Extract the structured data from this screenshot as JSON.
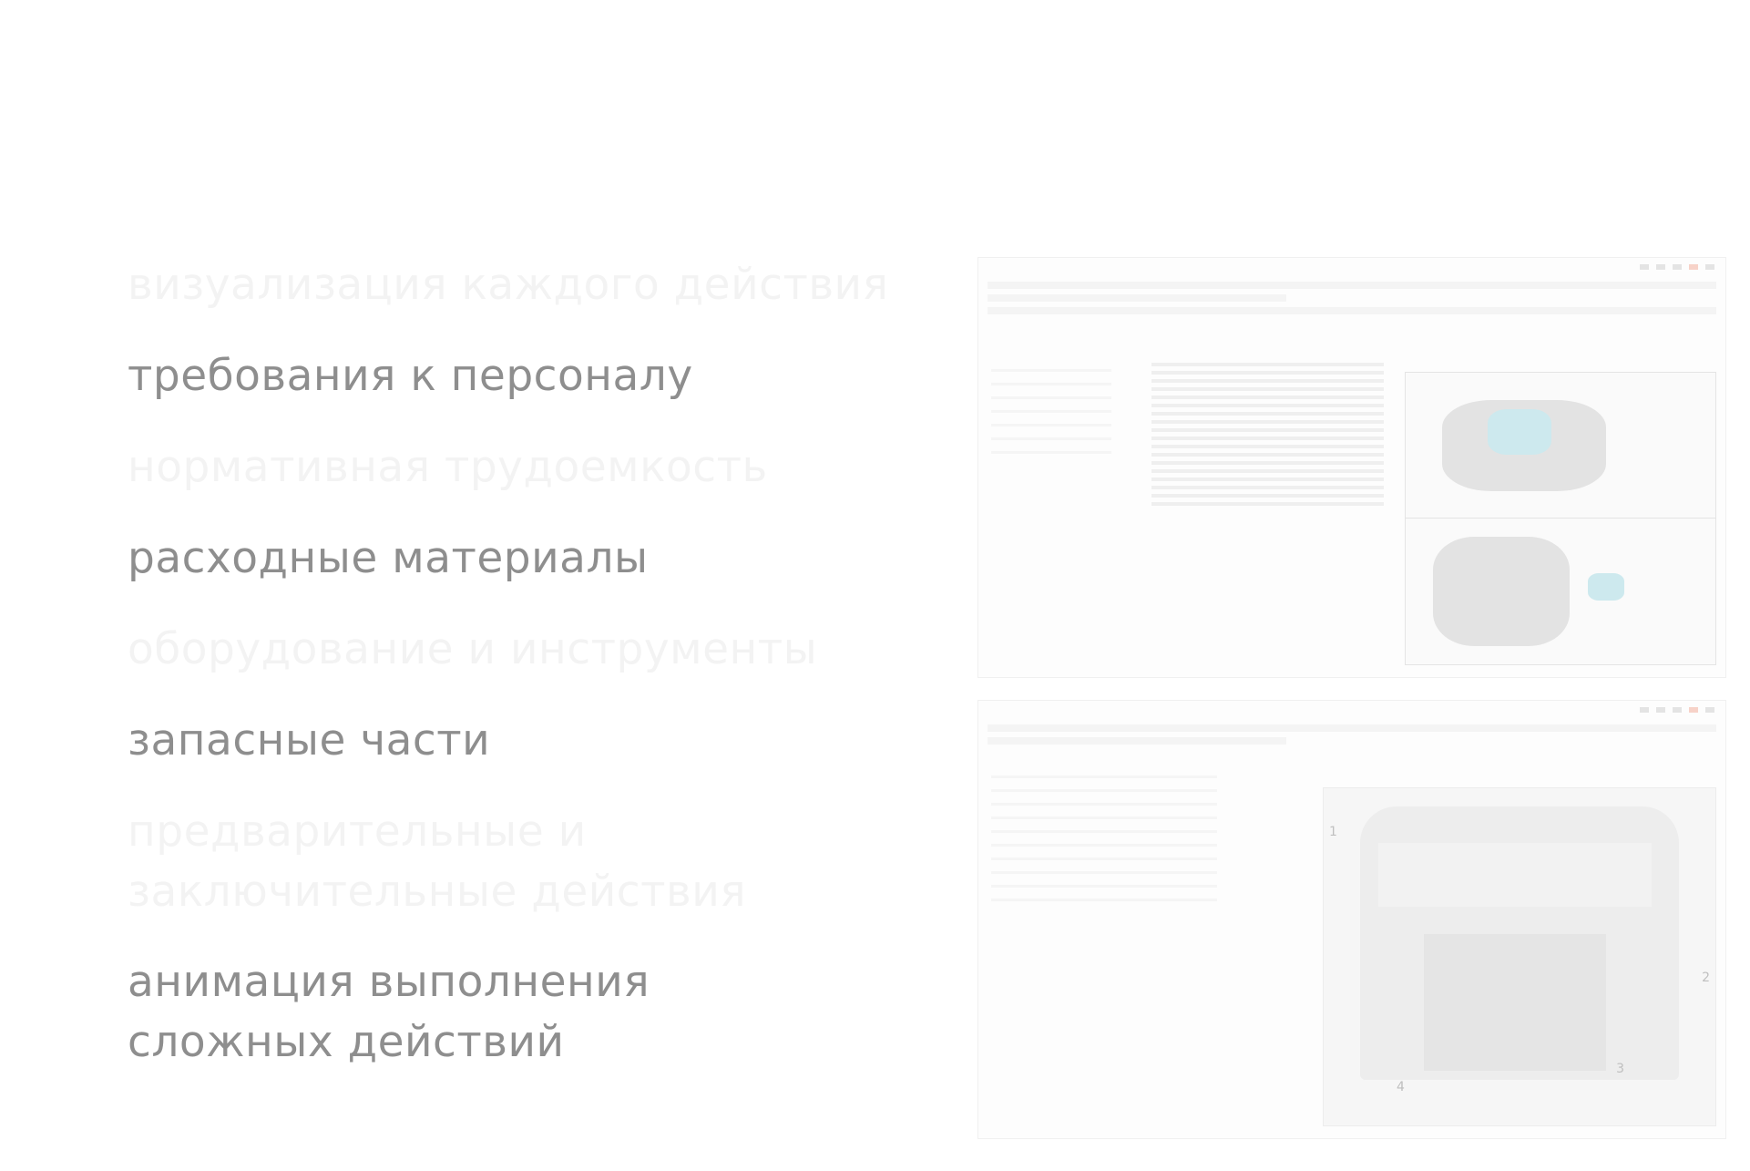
{
  "features": [
    {
      "label": "визуализация каждого действия",
      "visible": false
    },
    {
      "label": "требования к персоналу",
      "visible": true
    },
    {
      "label": "нормативная трудоемкость",
      "visible": false
    },
    {
      "label": "расходные материалы",
      "visible": true
    },
    {
      "label": "оборудование и инструменты",
      "visible": false
    },
    {
      "label": "запасные части",
      "visible": true
    },
    {
      "label": "предварительные и заключительные действия",
      "visible": false
    },
    {
      "label": "анимация выполнения сложных действий",
      "visible": true
    }
  ],
  "callouts": {
    "c1": "1",
    "c2": "2",
    "c3": "3",
    "c4": "4"
  },
  "colors": {
    "text_active": "#8e8e8e",
    "text_faded": "#f3f3f3",
    "accent_teal": "#cde9ee"
  }
}
